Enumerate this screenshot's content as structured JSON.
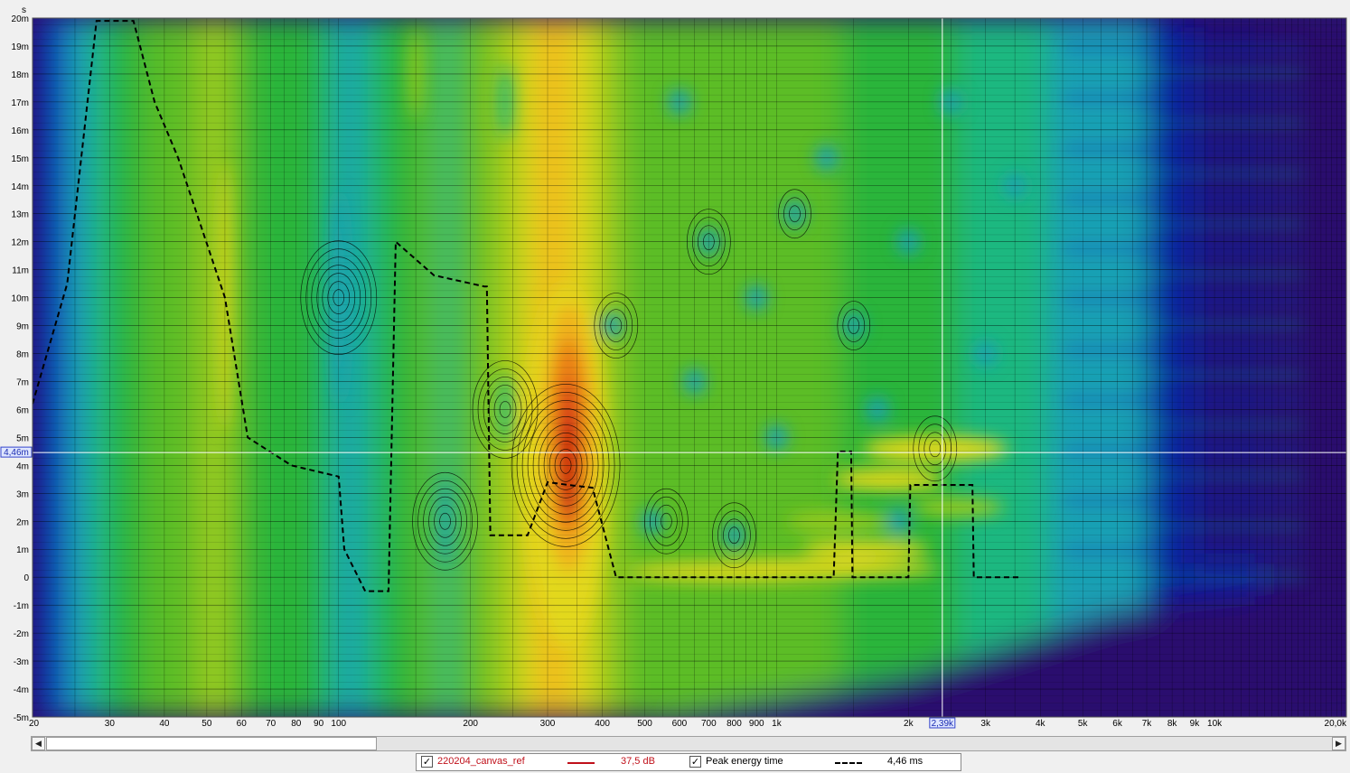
{
  "chart_data": {
    "type": "heatmap",
    "title": "",
    "xlabel": "",
    "ylabel": "s",
    "x_scale": "log",
    "xlim": [
      20,
      20000
    ],
    "ylim": [
      -5,
      20
    ],
    "x_tick_labels": [
      {
        "v": 20,
        "label": "20"
      },
      {
        "v": 30,
        "label": "30"
      },
      {
        "v": 40,
        "label": "40"
      },
      {
        "v": 50,
        "label": "50"
      },
      {
        "v": 60,
        "label": "60"
      },
      {
        "v": 70,
        "label": "70"
      },
      {
        "v": 80,
        "label": "80"
      },
      {
        "v": 90,
        "label": "90"
      },
      {
        "v": 100,
        "label": "100"
      },
      {
        "v": 200,
        "label": "200"
      },
      {
        "v": 300,
        "label": "300"
      },
      {
        "v": 400,
        "label": "400"
      },
      {
        "v": 500,
        "label": "500"
      },
      {
        "v": 600,
        "label": "600"
      },
      {
        "v": 700,
        "label": "700"
      },
      {
        "v": 800,
        "label": "800"
      },
      {
        "v": 900,
        "label": "900"
      },
      {
        "v": 1000,
        "label": "1k"
      },
      {
        "v": 2000,
        "label": "2k"
      },
      {
        "v": 3000,
        "label": "3k"
      },
      {
        "v": 4000,
        "label": "4k"
      },
      {
        "v": 5000,
        "label": "5k"
      },
      {
        "v": 6000,
        "label": "6k"
      },
      {
        "v": 7000,
        "label": "7k"
      },
      {
        "v": 8000,
        "label": "8k"
      },
      {
        "v": 9000,
        "label": "9k"
      },
      {
        "v": 10000,
        "label": "10k"
      },
      {
        "v": 20000,
        "label": "20,0k"
      }
    ],
    "y_tick_labels": [
      {
        "v": 20,
        "label": "20m"
      },
      {
        "v": 19,
        "label": "19m"
      },
      {
        "v": 18,
        "label": "18m"
      },
      {
        "v": 17,
        "label": "17m"
      },
      {
        "v": 16,
        "label": "16m"
      },
      {
        "v": 15,
        "label": "15m"
      },
      {
        "v": 14,
        "label": "14m"
      },
      {
        "v": 13,
        "label": "13m"
      },
      {
        "v": 12,
        "label": "12m"
      },
      {
        "v": 11,
        "label": "11m"
      },
      {
        "v": 10,
        "label": "10m"
      },
      {
        "v": 9,
        "label": "9m"
      },
      {
        "v": 8,
        "label": "8m"
      },
      {
        "v": 7,
        "label": "7m"
      },
      {
        "v": 6,
        "label": "6m"
      },
      {
        "v": 5,
        "label": "5m"
      },
      {
        "v": 4,
        "label": "4m"
      },
      {
        "v": 3,
        "label": "3m"
      },
      {
        "v": 2,
        "label": "2m"
      },
      {
        "v": 1,
        "label": "1m"
      },
      {
        "v": 0,
        "label": "0"
      },
      {
        "v": -1,
        "label": "-1m"
      },
      {
        "v": -2,
        "label": "-2m"
      },
      {
        "v": -3,
        "label": "-3m"
      },
      {
        "v": -4,
        "label": "-4m"
      },
      {
        "v": -5,
        "label": "-5m"
      }
    ],
    "cursor": {
      "x": 2390,
      "y": 4.46,
      "x_label": "2,39k",
      "y_label": "4,46m"
    },
    "colormap": [
      "#2a0e6e",
      "#0a1a9a",
      "#0d4fc0",
      "#1aa0b4",
      "#1fb880",
      "#2ab53a",
      "#5bbd28",
      "#9ccb1c",
      "#e2d81a",
      "#f0b21a",
      "#e97a18",
      "#d93a12",
      "#c40f0c"
    ],
    "grid": true,
    "background_color": "#2a0e6e",
    "peak_energy_time": [
      {
        "x": 20,
        "y": 6.2
      },
      {
        "x": 24,
        "y": 10.5
      },
      {
        "x": 28,
        "y": 19.9
      },
      {
        "x": 34,
        "y": 19.9
      },
      {
        "x": 38,
        "y": 17
      },
      {
        "x": 43,
        "y": 15
      },
      {
        "x": 55,
        "y": 10
      },
      {
        "x": 62,
        "y": 5
      },
      {
        "x": 78,
        "y": 4
      },
      {
        "x": 100,
        "y": 3.6
      },
      {
        "x": 103,
        "y": 1
      },
      {
        "x": 115,
        "y": -0.5
      },
      {
        "x": 130,
        "y": -0.5
      },
      {
        "x": 135,
        "y": 12
      },
      {
        "x": 165,
        "y": 10.8
      },
      {
        "x": 215,
        "y": 10.4
      },
      {
        "x": 218,
        "y": 10.4
      },
      {
        "x": 222,
        "y": 1.5
      },
      {
        "x": 270,
        "y": 1.5
      },
      {
        "x": 300,
        "y": 3.4
      },
      {
        "x": 335,
        "y": 3.3
      },
      {
        "x": 380,
        "y": 3.2
      },
      {
        "x": 430,
        "y": 0
      },
      {
        "x": 1000,
        "y": 0
      },
      {
        "x": 1350,
        "y": 0
      },
      {
        "x": 1380,
        "y": 4.5
      },
      {
        "x": 1480,
        "y": 4.5
      },
      {
        "x": 1490,
        "y": 0
      },
      {
        "x": 2000,
        "y": 0
      },
      {
        "x": 2020,
        "y": 3.3
      },
      {
        "x": 2800,
        "y": 3.3
      },
      {
        "x": 2820,
        "y": 0
      },
      {
        "x": 3600,
        "y": 0
      }
    ],
    "series": [
      {
        "name": "220204_canvas_ref",
        "color": "#c0101a",
        "value": "37,5 dB",
        "visible": true
      },
      {
        "name": "Peak energy time",
        "color": "#000000",
        "value": "4,46 ms",
        "visible": true
      }
    ]
  },
  "legend": {
    "check_glyph": "✓",
    "items": [
      {
        "name": "220204_canvas_ref",
        "value": "37,5 dB"
      },
      {
        "name": "Peak energy time",
        "value": "4,46 ms"
      }
    ]
  },
  "scrollbar": {
    "left_arrow": "◀",
    "right_arrow": "▶"
  }
}
